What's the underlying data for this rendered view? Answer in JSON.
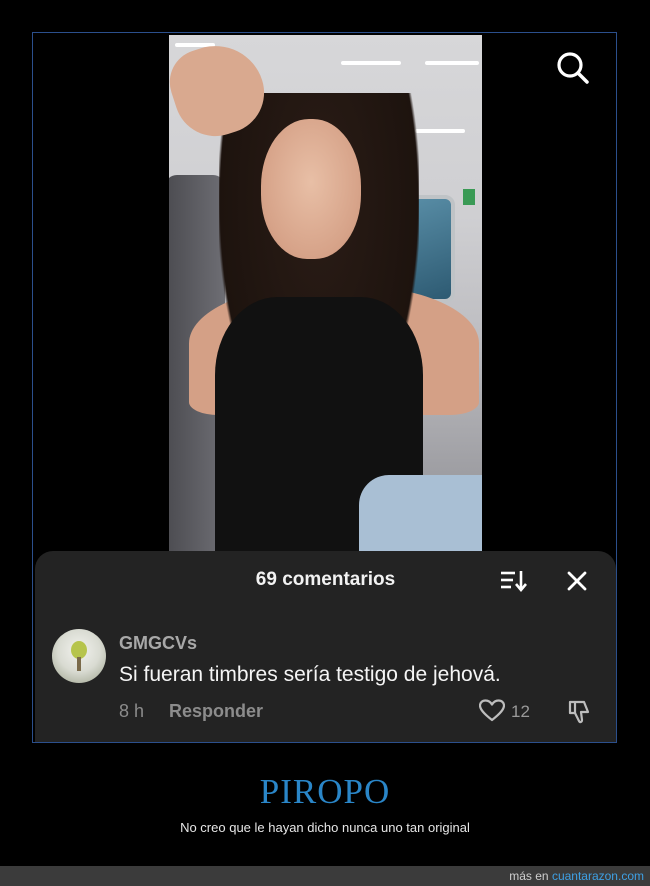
{
  "comments_panel": {
    "title": "69 comentarios"
  },
  "comment": {
    "username": "GMGCVs",
    "text": "Si fueran timbres sería testigo de jehová.",
    "time": "8 h",
    "reply_label": "Responder",
    "like_count": "12"
  },
  "caption": {
    "title": "PIROPO",
    "subtitle": "No creo que le hayan dicho nunca uno tan original"
  },
  "footer": {
    "prefix": "más en ",
    "link": "cuantarazon.com"
  },
  "icons": {
    "search": "search-icon",
    "sort": "sort-icon",
    "close": "close-icon",
    "like": "heart-icon",
    "dislike": "dislike-icon"
  },
  "colors": {
    "panel_bg": "#232323",
    "frame_border": "#2b4f8c",
    "caption_title": "#2a86c8",
    "footer_link": "#3ea0e4"
  }
}
